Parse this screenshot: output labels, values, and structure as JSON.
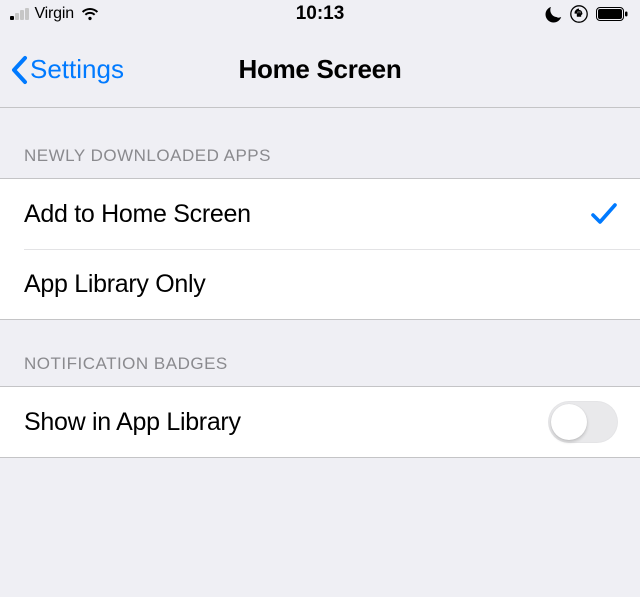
{
  "status_bar": {
    "carrier": "Virgin",
    "time": "10:13"
  },
  "nav": {
    "back_label": "Settings",
    "title": "Home Screen"
  },
  "sections": {
    "newly_downloaded": {
      "header": "NEWLY DOWNLOADED APPS",
      "options": {
        "add_home": {
          "label": "Add to Home Screen",
          "selected": true
        },
        "app_library_only": {
          "label": "App Library Only",
          "selected": false
        }
      }
    },
    "notification_badges": {
      "header": "NOTIFICATION BADGES",
      "show_in_library": {
        "label": "Show in App Library",
        "enabled": false
      }
    }
  },
  "colors": {
    "accent": "#007aff",
    "grouped_bg": "#efeff4",
    "separator": "#c4c4c6",
    "secondary_text": "#8a8a8e"
  }
}
